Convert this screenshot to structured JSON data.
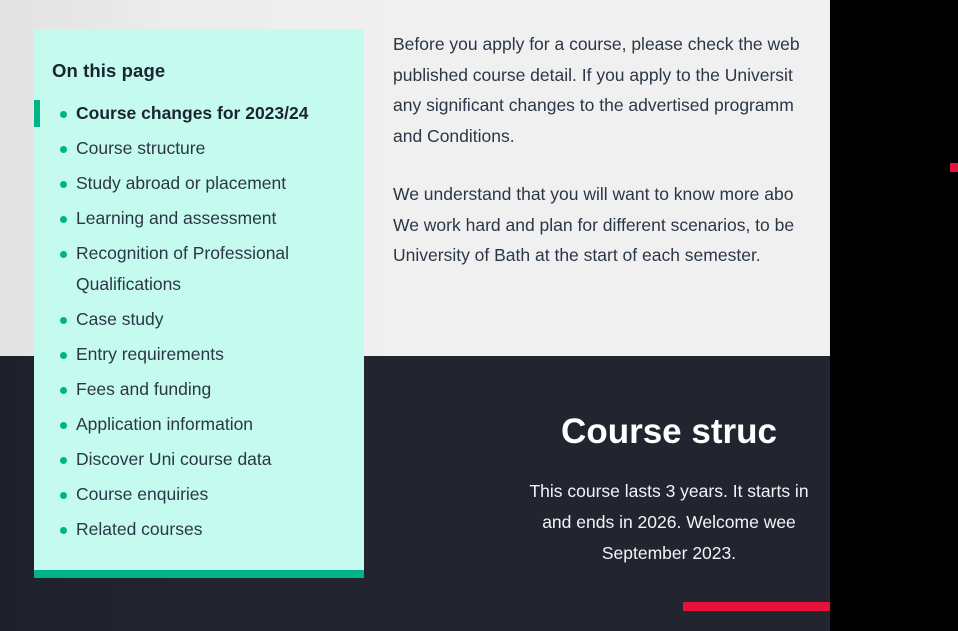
{
  "colors": {
    "panel_bg": "#c4fbee",
    "accent_green": "#00b388",
    "accent_red": "#e8113c",
    "dark_bg": "#22252f",
    "body_text": "#2b3746",
    "page_bg": "#efefef"
  },
  "on_this_page": {
    "title": "On this page",
    "items": [
      {
        "label": "Course changes for 2023/24",
        "active": true
      },
      {
        "label": "Course structure",
        "active": false
      },
      {
        "label": "Study abroad or placement",
        "active": false
      },
      {
        "label": "Learning and assessment",
        "active": false
      },
      {
        "label": "Recognition of Professional Qualifications",
        "active": false
      },
      {
        "label": "Case study",
        "active": false
      },
      {
        "label": "Entry requirements",
        "active": false
      },
      {
        "label": "Fees and funding",
        "active": false
      },
      {
        "label": "Application information",
        "active": false
      },
      {
        "label": "Discover Uni course data",
        "active": false
      },
      {
        "label": "Course enquiries",
        "active": false
      },
      {
        "label": "Related courses",
        "active": false
      }
    ]
  },
  "article": {
    "paragraph_1": {
      "line_1": "Before you apply for a course, please check the web",
      "line_2": "published course detail. If you apply to the Universit",
      "line_3": "any significant changes to the advertised programm",
      "line_4": "and Conditions."
    },
    "paragraph_2": {
      "line_1": "We understand that you will want to know more abo",
      "line_2": "We work hard and plan for different scenarios, to be",
      "line_3": "University of Bath at the start of each semester."
    }
  },
  "course_structure": {
    "heading": "Course struc",
    "paragraph": {
      "line_1": "This course lasts 3 years. It starts in",
      "line_2": "and ends in 2026. Welcome wee",
      "line_3": "September 2023."
    }
  }
}
